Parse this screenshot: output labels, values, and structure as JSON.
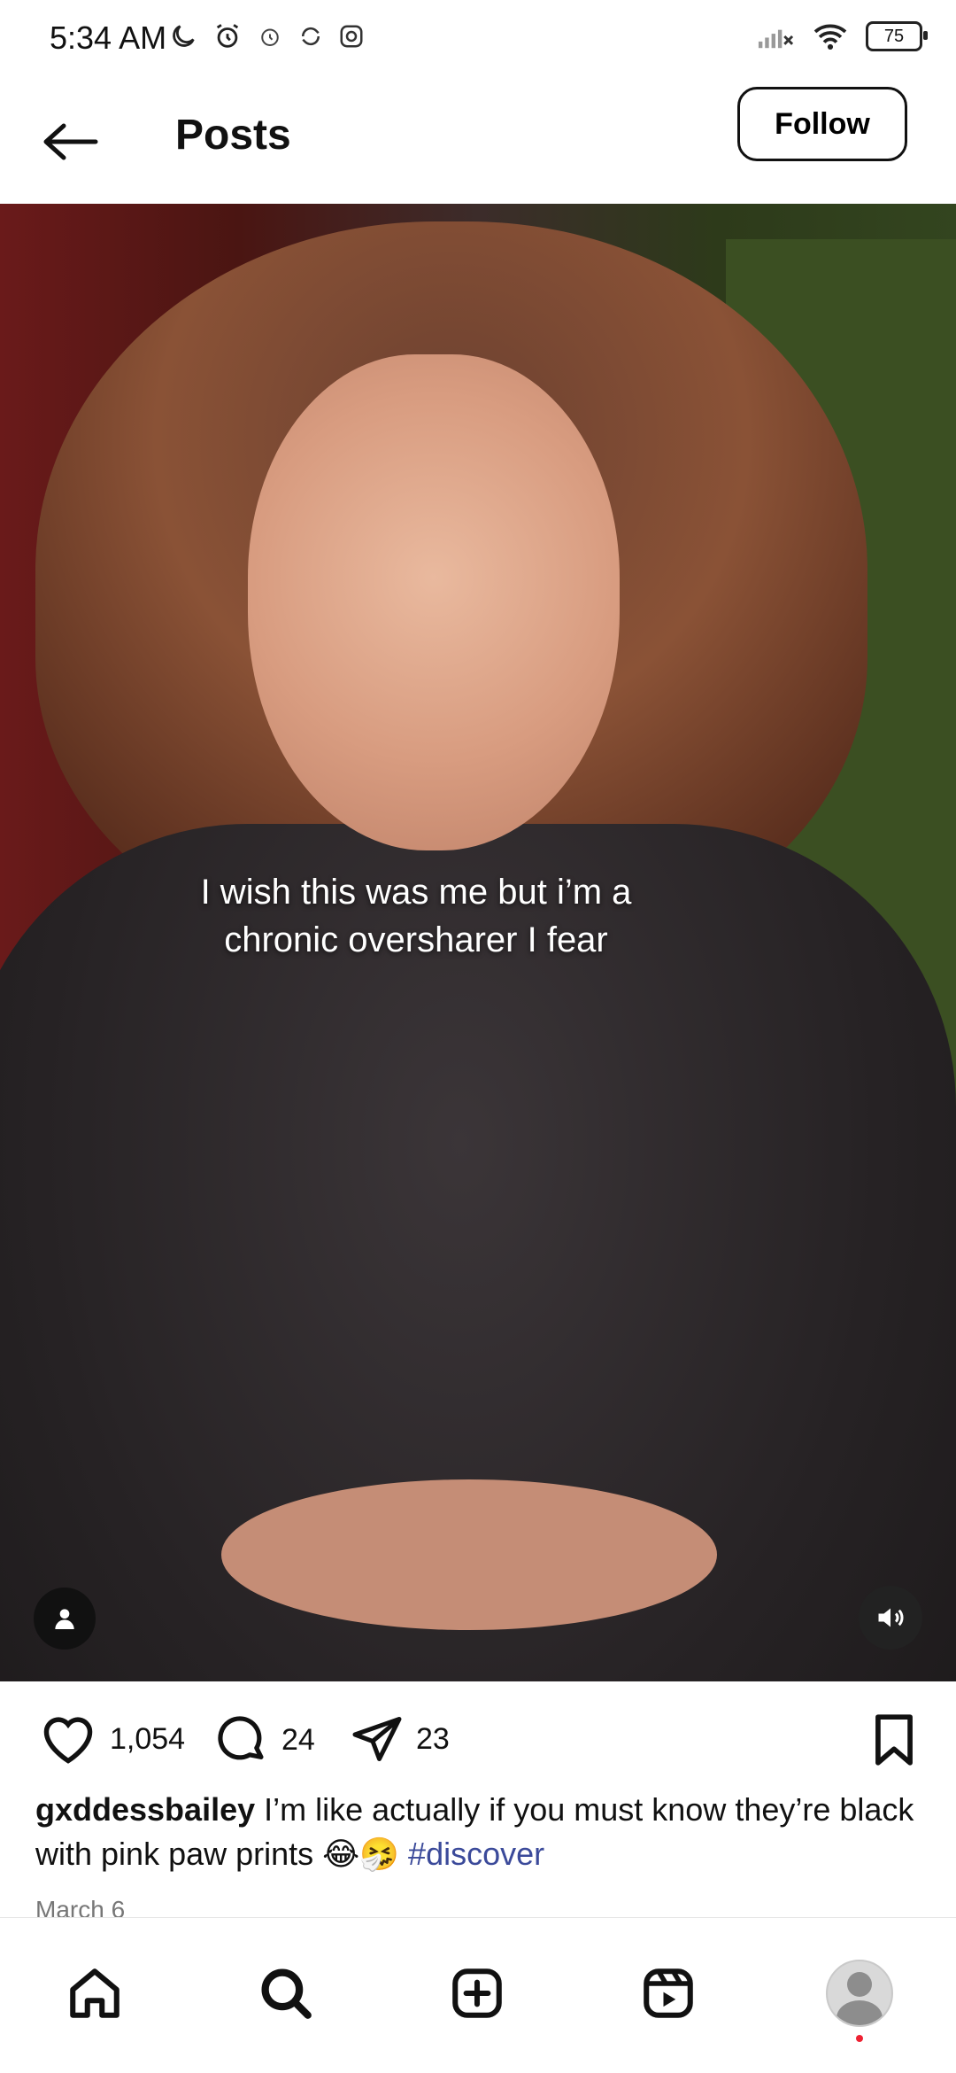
{
  "status_bar": {
    "time": "5:34 AM",
    "battery": "75"
  },
  "header": {
    "title": "Posts",
    "follow_label": "Follow"
  },
  "media": {
    "overlay_text": "I wish this was me but i’m a chronic oversharer I fear"
  },
  "actions": {
    "likes": "1,054",
    "comments": "24",
    "shares": "23"
  },
  "caption": {
    "username": "gxddessbailey",
    "text": "I’m like actually if you must know they’re black with pink paw prints 😂🤧",
    "hashtag": "#discover"
  },
  "date": "March 6",
  "nav": {
    "icons": [
      "home-icon",
      "search-icon",
      "create-icon",
      "reels-icon",
      "profile-avatar"
    ]
  },
  "colors": {
    "hashtag": "#3b4a9a",
    "notification_dot": "#e22233"
  }
}
